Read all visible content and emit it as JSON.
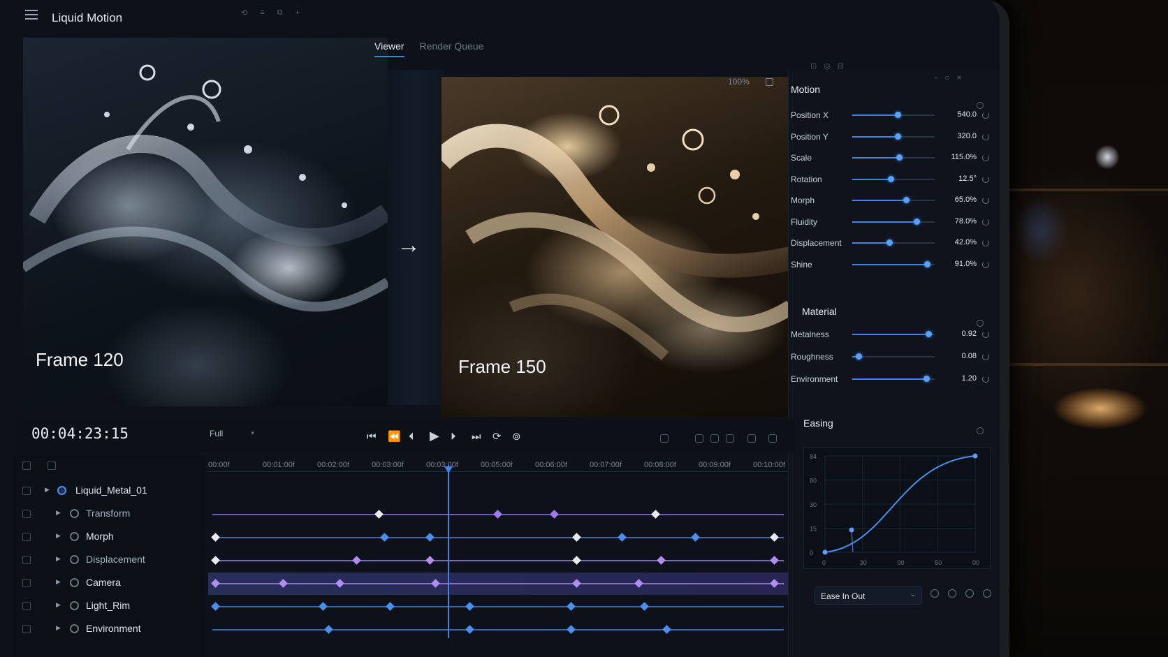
{
  "app": {
    "title": "Liquid Motion"
  },
  "viewer": {
    "tabs": [
      {
        "label": "Viewer",
        "active": true
      },
      {
        "label": "Render Queue",
        "active": false
      }
    ],
    "zoom": "100%",
    "left_frame_label": "Frame 120",
    "right_frame_label": "Frame 150"
  },
  "motion": {
    "title": "Motion",
    "properties": [
      {
        "label": "Position X",
        "value": "540.0",
        "level": 0.55
      },
      {
        "label": "Position Y",
        "value": "320.0",
        "level": 0.55
      },
      {
        "label": "Scale",
        "value": "115.0%",
        "level": 0.57
      },
      {
        "label": "Rotation",
        "value": "12.5°",
        "level": 0.47
      },
      {
        "label": "Morph",
        "value": "65.0%",
        "level": 0.65
      },
      {
        "label": "Fluidity",
        "value": "78.0%",
        "level": 0.78
      },
      {
        "label": "Displacement",
        "value": "42.0%",
        "level": 0.45
      },
      {
        "label": "Shine",
        "value": "91.0%",
        "level": 0.91
      }
    ]
  },
  "material": {
    "title": "Material",
    "properties": [
      {
        "label": "Metalness",
        "value": "0.92",
        "level": 0.92
      },
      {
        "label": "Roughness",
        "value": "0.08",
        "level": 0.08
      },
      {
        "label": "Environment",
        "value": "1.20",
        "level": 0.9
      }
    ]
  },
  "easing": {
    "title": "Easing",
    "preset": "Ease In Out",
    "y_ticks": [
      "84",
      "80",
      "30",
      "15",
      "0"
    ],
    "x_ticks": [
      "0",
      "30",
      "00",
      "50",
      "00"
    ]
  },
  "transport": {
    "timecode": "00:04:23:15",
    "resolution": "Full"
  },
  "timeline": {
    "ticks": [
      "00:00f",
      "00:01:00f",
      "00:02:00f",
      "00:03:00f",
      "00:03:00f",
      "00:05:00f",
      "00:06:00f",
      "00:07:00f",
      "00:08:00f",
      "00:09:00f",
      "00:10:00f"
    ],
    "playhead_fraction": 0.413,
    "layers": [
      {
        "name": "Liquid_Metal_01",
        "indent": 0,
        "highlight": false,
        "color": "#4a8ff0"
      },
      {
        "name": "Transform",
        "indent": 1,
        "highlight": false,
        "color": "#9d7cf0"
      },
      {
        "name": "Morph",
        "indent": 1,
        "highlight": false,
        "color": "#4a8ff0"
      },
      {
        "name": "Displacement",
        "indent": 1,
        "highlight": false,
        "color": "#b08cf5"
      },
      {
        "name": "Camera",
        "indent": 1,
        "highlight": true,
        "color": "#b08cf5"
      },
      {
        "name": "Light_Rim",
        "indent": 1,
        "highlight": false,
        "color": "#4a8ff0"
      },
      {
        "name": "Environment",
        "indent": 1,
        "highlight": false,
        "color": "#4a8ff0"
      }
    ]
  },
  "colors": {
    "accent": "#3f84e6",
    "key_purple": "#b08cf5",
    "key_white": "#e8ecf2"
  }
}
